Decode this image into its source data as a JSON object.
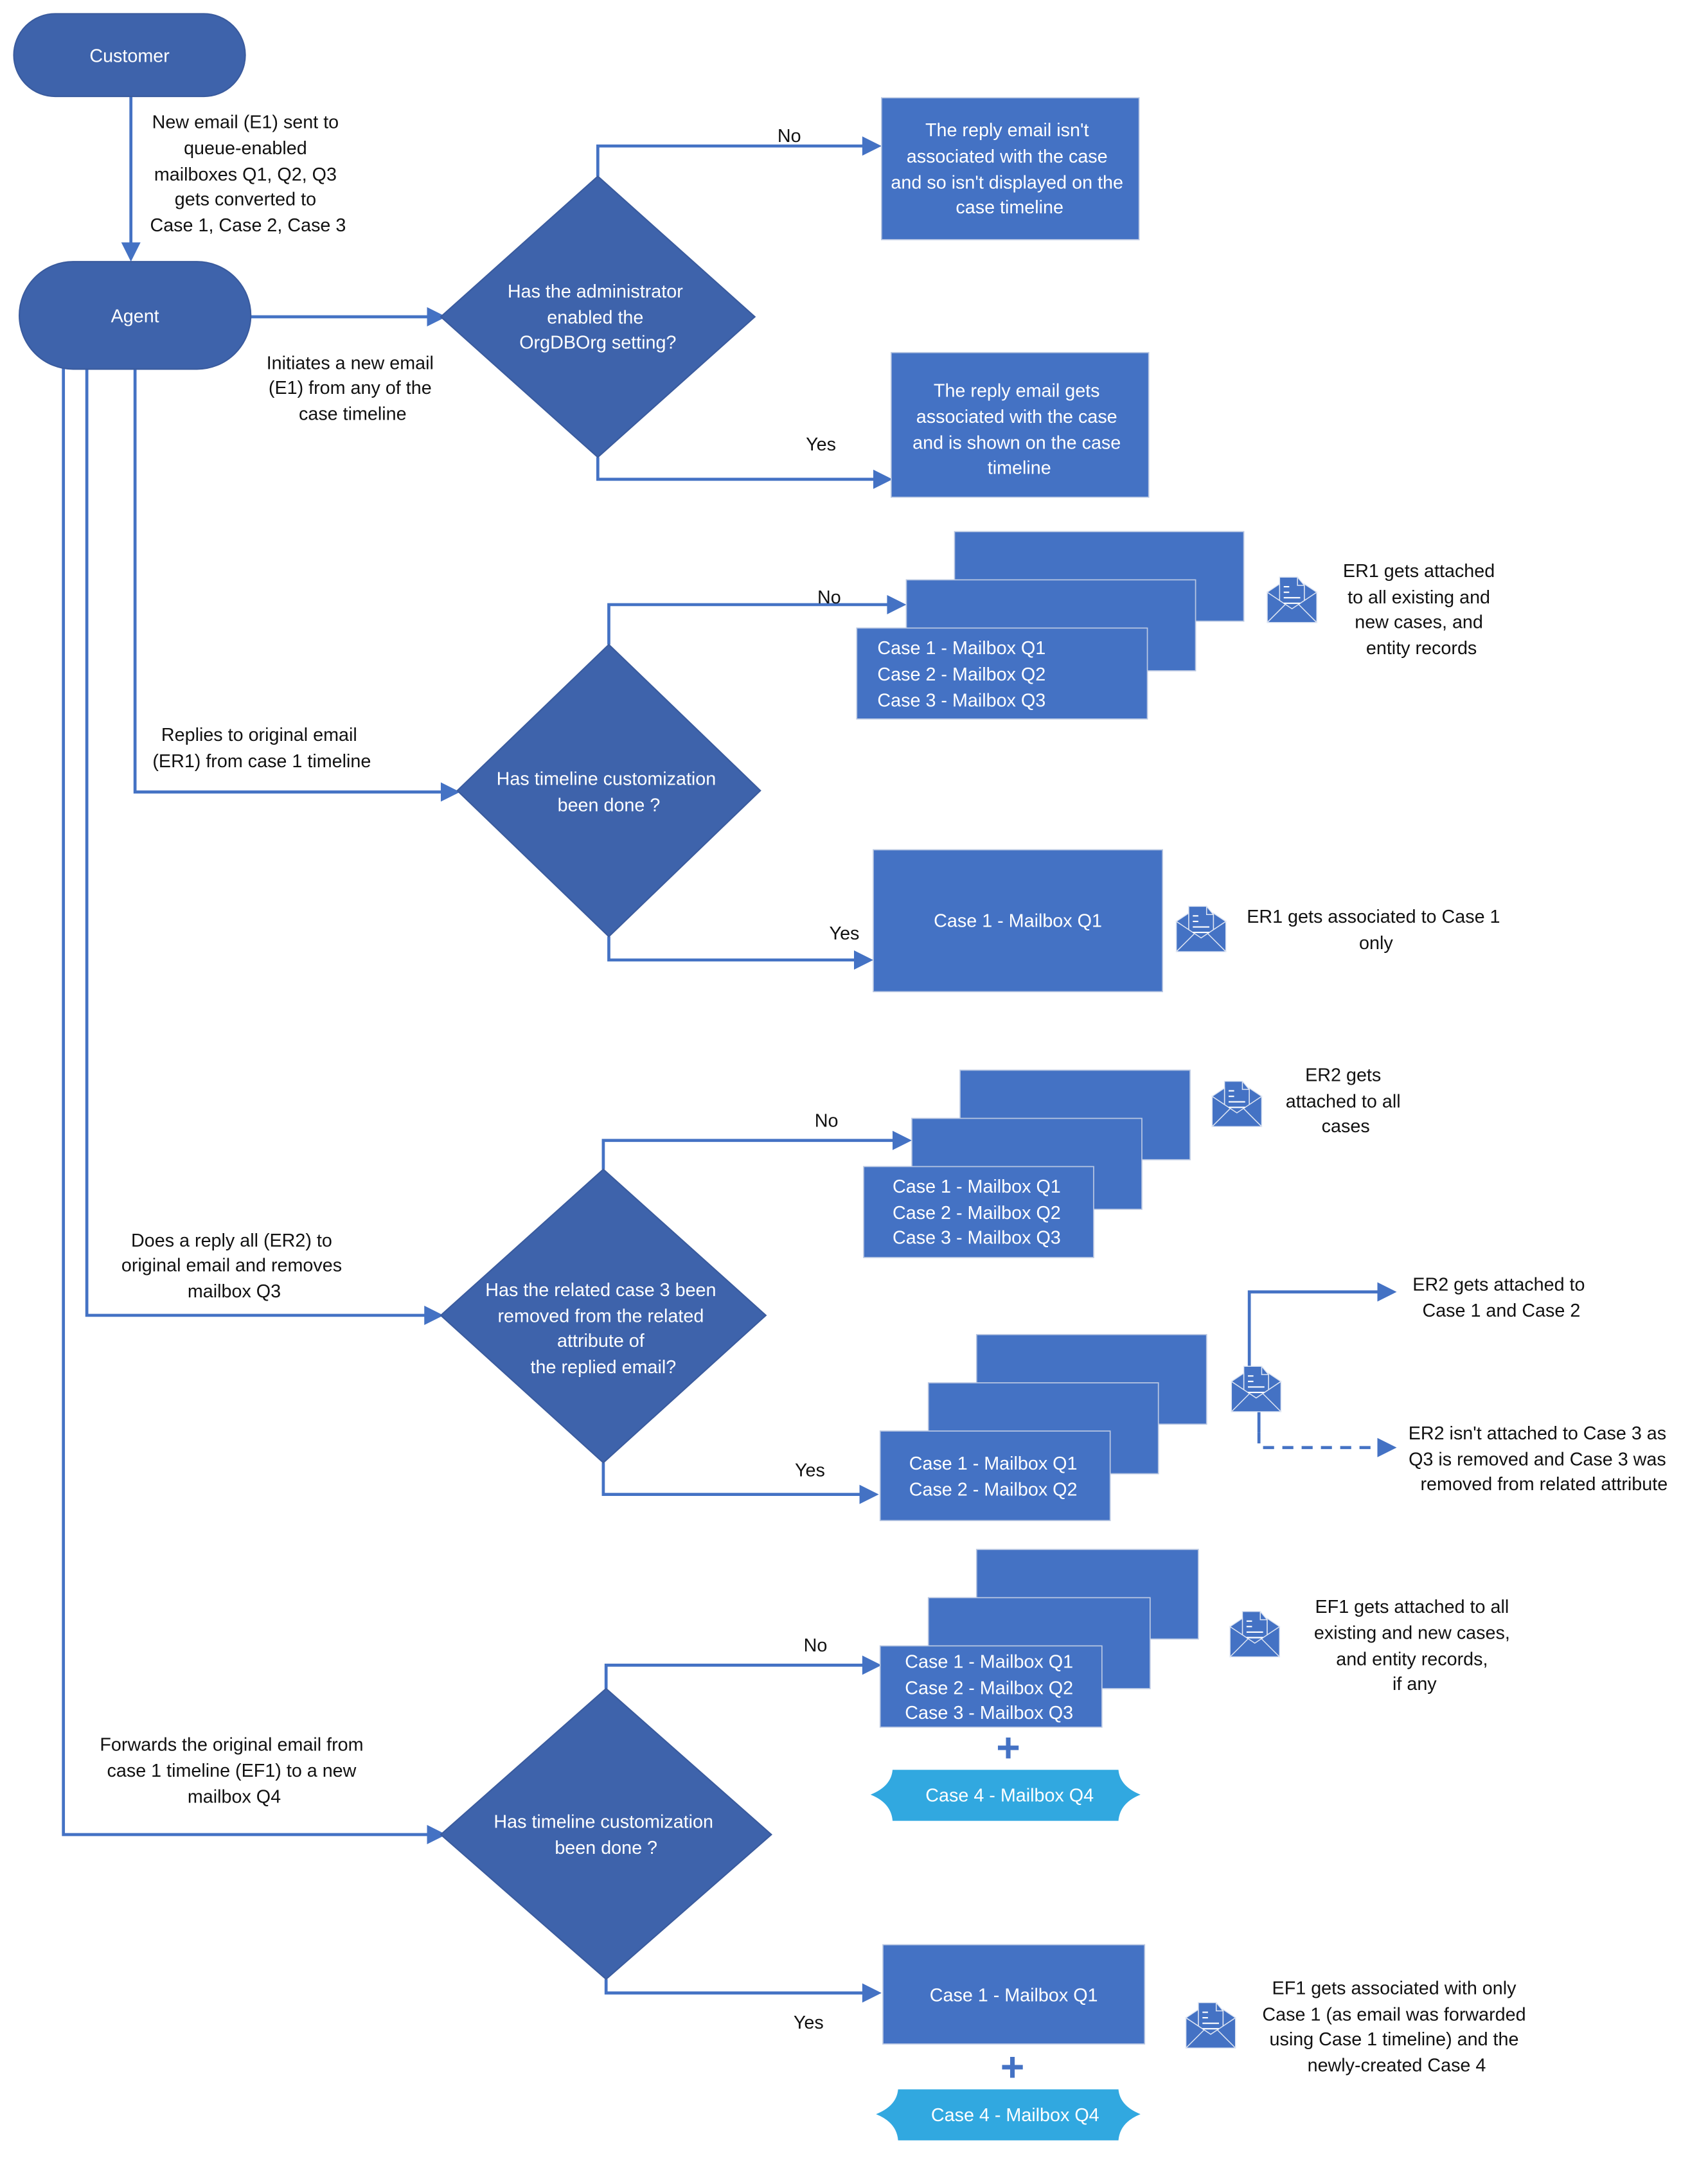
{
  "colors": {
    "terminal": "#3e63ab",
    "decision": "#3e63ab",
    "process": "#4472c4",
    "new_case": "#31a8e0",
    "connector": "#4472c4"
  },
  "nodes": {
    "customer": "Customer",
    "agent": "Agent"
  },
  "edges": {
    "customer_to_agent": [
      "New email (E1) sent to",
      "queue-enabled",
      "mailboxes Q1, Q2, Q3",
      "gets converted to",
      "Case 1, Case 2, Case 3"
    ],
    "initiate": [
      "Initiates a new email",
      "(E1) from any of the",
      "case timeline"
    ],
    "reply": [
      "Replies to original email",
      "(ER1) from case 1 timeline"
    ],
    "reply_all": [
      "Does a reply all (ER2) to",
      "original email and removes",
      "mailbox Q3"
    ],
    "forward": [
      "Forwards the original email from",
      "case 1 timeline (EF1) to a new",
      "mailbox Q4"
    ]
  },
  "branch_labels": {
    "no": "No",
    "yes": "Yes"
  },
  "sections": [
    {
      "decision": [
        "Has the administrator",
        "enabled the",
        "OrgDBOrg setting?"
      ],
      "no_result": [
        "The reply email isn't",
        "associated with the case",
        "and so isn't displayed on the",
        "case timeline"
      ],
      "yes_result": [
        "The reply email gets",
        "associated with the case",
        "and is shown on the case",
        "timeline"
      ]
    },
    {
      "decision": [
        "Has timeline customization",
        "been done ?"
      ],
      "no_cases": [
        "Case 1 - Mailbox Q1",
        "Case 2 - Mailbox Q2",
        "Case 3 - Mailbox Q3"
      ],
      "no_note": [
        "ER1 gets attached",
        "to all existing and",
        "new cases, and",
        "entity records"
      ],
      "yes_cases": [
        "Case 1 - Mailbox Q1"
      ],
      "yes_note": [
        "ER1 gets associated to Case 1",
        "only"
      ]
    },
    {
      "decision": [
        "Has the related case 3 been",
        "removed from the related",
        "attribute of",
        "the replied email?"
      ],
      "no_cases": [
        "Case 1 - Mailbox Q1",
        "Case 2 - Mailbox Q2",
        "Case 3 - Mailbox Q3"
      ],
      "no_note": [
        "ER2 gets",
        "attached to all",
        "cases"
      ],
      "yes_cases": [
        "Case 1 - Mailbox Q1",
        "Case 2 - Mailbox Q2"
      ],
      "yes_note_attached": [
        "ER2 gets attached to",
        "Case 1 and Case 2"
      ],
      "yes_note_not_attached": [
        "ER2 isn't attached to Case 3 as",
        "Q3 is removed and Case 3 was",
        "removed from related attribute"
      ]
    },
    {
      "decision": [
        "Has timeline customization",
        "been done ?"
      ],
      "no_cases": [
        "Case 1 - Mailbox Q1",
        "Case 2 - Mailbox Q2",
        "Case 3 - Mailbox Q3"
      ],
      "no_plus": "+",
      "no_new_case": "Case 4 - Mailbox Q4",
      "no_note": [
        "EF1 gets attached to all",
        "existing and new cases,",
        "and entity records,",
        "if any"
      ],
      "yes_cases": [
        "Case 1 - Mailbox Q1"
      ],
      "yes_plus": "+",
      "yes_new_case": "Case 4 - Mailbox Q4",
      "yes_note": [
        "EF1 gets associated with only",
        "Case 1 (as email was forwarded",
        "using Case 1 timeline) and the",
        "newly-created Case 4"
      ]
    }
  ]
}
